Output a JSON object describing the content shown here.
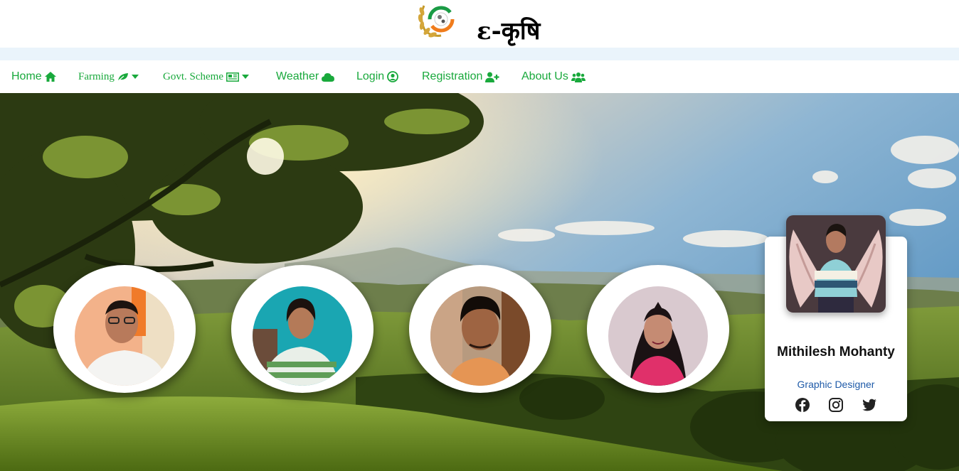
{
  "site": {
    "title": "ε-कृषि"
  },
  "nav": {
    "home": "Home",
    "farming": "Farming",
    "scheme": "Govt. Scheme",
    "weather": "Weather",
    "login": "Login",
    "registration": "Registration",
    "about": "About Us"
  },
  "featured_member": {
    "name": "Mithilesh Mohanty",
    "role": "Graphic Designer",
    "socials": [
      "facebook-icon",
      "instagram-icon",
      "twitter-icon"
    ]
  },
  "colors": {
    "accent": "#19a93c",
    "role": "#1e5aa8"
  }
}
